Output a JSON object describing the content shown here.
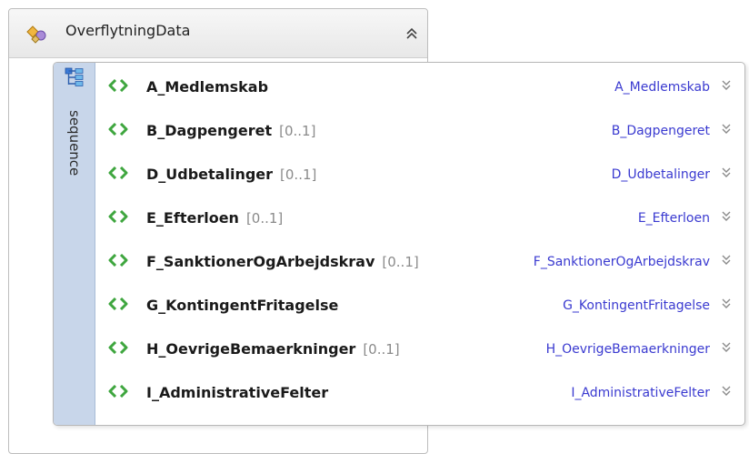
{
  "complex_type": {
    "name": "OverflytningData",
    "icon": "complex-type-icon",
    "collapse_icon": "double-chevron-up-icon"
  },
  "sequence": {
    "label": "sequence",
    "icon": "sequence-icon"
  },
  "elements": [
    {
      "name": "A_Medlemskab",
      "cardinality": "",
      "type": "A_Medlemskab"
    },
    {
      "name": "B_Dagpengeret",
      "cardinality": "[0..1]",
      "type": "B_Dagpengeret"
    },
    {
      "name": "D_Udbetalinger",
      "cardinality": "[0..1]",
      "type": "D_Udbetalinger"
    },
    {
      "name": "E_Efterloen",
      "cardinality": "[0..1]",
      "type": "E_Efterloen"
    },
    {
      "name": "F_SanktionerOgArbejdskrav",
      "cardinality": "[0..1]",
      "type": "F_SanktionerOgArbejdskrav"
    },
    {
      "name": "G_KontingentFritagelse",
      "cardinality": "",
      "type": "G_KontingentFritagelse"
    },
    {
      "name": "H_OevrigeBemaerkninger",
      "cardinality": "[0..1]",
      "type": "H_OevrigeBemaerkninger"
    },
    {
      "name": "I_AdministrativeFelter",
      "cardinality": "",
      "type": "I_AdministrativeFelter"
    }
  ],
  "colors": {
    "type_link": "#3a3ad0",
    "element_icon": "#3fa63f",
    "sequence_bar": "#c8d6ea"
  }
}
